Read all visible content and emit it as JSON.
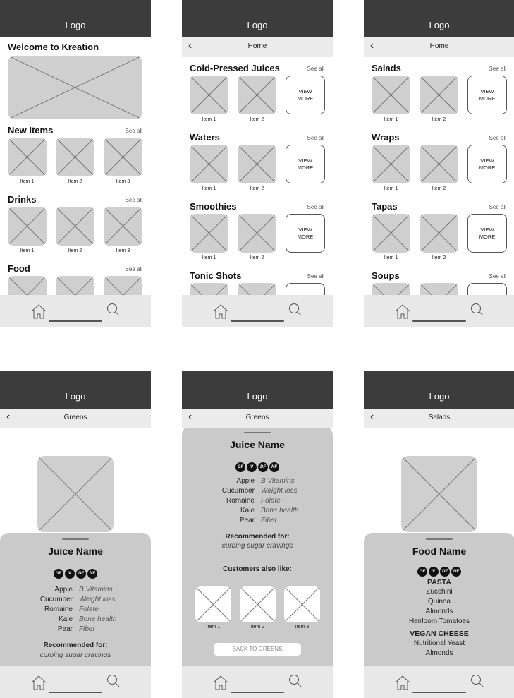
{
  "logo": "Logo",
  "nav": {
    "home_icon": "home-icon",
    "search_icon": "search-icon"
  },
  "screen1": {
    "title": "Welcome to Kreation",
    "sections": [
      {
        "title": "New Items",
        "see_all": "See all",
        "items": [
          "Item 1",
          "Item 2",
          "Item 3"
        ]
      },
      {
        "title": "Drinks",
        "see_all": "See all",
        "items": [
          "Item 1",
          "Item 2",
          "Item 3"
        ]
      },
      {
        "title": "Food",
        "see_all": "See all",
        "items": [
          "",
          "",
          ""
        ]
      }
    ]
  },
  "screen2": {
    "subtitle": "Home",
    "view_more": "VIEW\nMORE",
    "sections": [
      {
        "title": "Cold-Pressed Juices",
        "see_all": "See all",
        "items": [
          "Item 1",
          "Item 2"
        ]
      },
      {
        "title": "Waters",
        "see_all": "See all",
        "items": [
          "Item 1",
          "Item 2"
        ]
      },
      {
        "title": "Smoothies",
        "see_all": "See all",
        "items": [
          "Item 1",
          "Item 2"
        ]
      },
      {
        "title": "Tonic Shots",
        "see_all": "See all",
        "items": [
          "",
          ""
        ]
      }
    ]
  },
  "screen3": {
    "subtitle": "Home",
    "view_more": "VIEW\nMORE",
    "sections": [
      {
        "title": "Salads",
        "see_all": "See all",
        "items": [
          "Item 1",
          "Item 2"
        ]
      },
      {
        "title": "Wraps",
        "see_all": "See all",
        "items": [
          "Item 1",
          "Item 2"
        ]
      },
      {
        "title": "Tapas",
        "see_all": "See all",
        "items": [
          "Item 1",
          "Item 2"
        ]
      },
      {
        "title": "Soups",
        "see_all": "See all",
        "items": [
          "",
          ""
        ]
      }
    ]
  },
  "screen4": {
    "subtitle": "Greens",
    "name": "Juice Name",
    "badges": [
      "GF",
      "V",
      "DF",
      "NF"
    ],
    "ingredients": [
      {
        "name": "Apple",
        "benefit": "B Vitamins"
      },
      {
        "name": "Cucumber",
        "benefit": "Weight loss"
      },
      {
        "name": "Romaine",
        "benefit": "Folate"
      },
      {
        "name": "Kale",
        "benefit": "Bone health"
      },
      {
        "name": "Pear",
        "benefit": "Fiber"
      }
    ],
    "recommended_heading": "Recommended for:",
    "recommended_text": "curbing sugar cravings"
  },
  "screen5": {
    "subtitle": "Greens",
    "name": "Juice Name",
    "badges": [
      "GF",
      "V",
      "DF",
      "NF"
    ],
    "ingredients": [
      {
        "name": "Apple",
        "benefit": "B Vitamins"
      },
      {
        "name": "Cucumber",
        "benefit": "Weight loss"
      },
      {
        "name": "Romaine",
        "benefit": "Folate"
      },
      {
        "name": "Kale",
        "benefit": "Bone health"
      },
      {
        "name": "Pear",
        "benefit": "Fiber"
      }
    ],
    "recommended_heading": "Recommended for:",
    "recommended_text": "curbing sugar cravings",
    "also_like": "Customers also like:",
    "items": [
      "Item 1",
      "Item 2",
      "Item 3"
    ],
    "back_button": "BACK TO GREENS"
  },
  "screen6": {
    "subtitle": "Salads",
    "name": "Food Name",
    "badges": [
      "GF",
      "V",
      "DF",
      "NF"
    ],
    "groups": [
      {
        "heading": "PASTA",
        "items": [
          "Zucchini",
          "Quinoa",
          "Almonds",
          "Heirloom Tomatoes"
        ]
      },
      {
        "heading": "VEGAN CHEESE",
        "items": [
          "Nutritional Yeast",
          "Almonds"
        ]
      }
    ]
  }
}
